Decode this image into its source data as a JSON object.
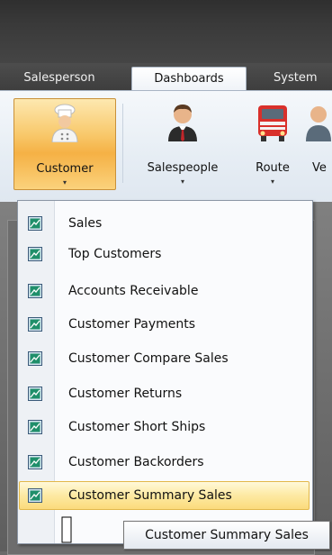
{
  "tabs": [
    {
      "label": "Salesperson",
      "active": false
    },
    {
      "label": "Dashboards",
      "active": true
    },
    {
      "label": "System",
      "active": false
    }
  ],
  "ribbon": {
    "buttons": [
      {
        "label": "Customer",
        "icon": "chef-icon",
        "pressed": true
      },
      {
        "label": "Salespeople",
        "icon": "salesperson-icon",
        "pressed": false
      },
      {
        "label": "Route",
        "icon": "truck-icon",
        "pressed": false
      },
      {
        "label": "Ve",
        "icon": "person-icon",
        "pressed": false
      }
    ],
    "dropdown_glyph": "▾"
  },
  "menu": {
    "items": [
      {
        "label": "Sales"
      },
      {
        "label": "Top Customers"
      },
      {
        "label": "Accounts Receivable"
      },
      {
        "label": "Customer Payments"
      },
      {
        "label": "Customer Compare Sales"
      },
      {
        "label": "Customer Returns"
      },
      {
        "label": "Customer Short Ships"
      },
      {
        "label": "Customer Backorders"
      },
      {
        "label": "Customer Summary Sales",
        "hover": true
      }
    ]
  },
  "tooltip": {
    "text": "Customer Summary Sales"
  },
  "colors": {
    "menu_item_icon": "#1f8f6a",
    "pressed_button": "#f5b145",
    "hover_item": "#fde9a2"
  }
}
